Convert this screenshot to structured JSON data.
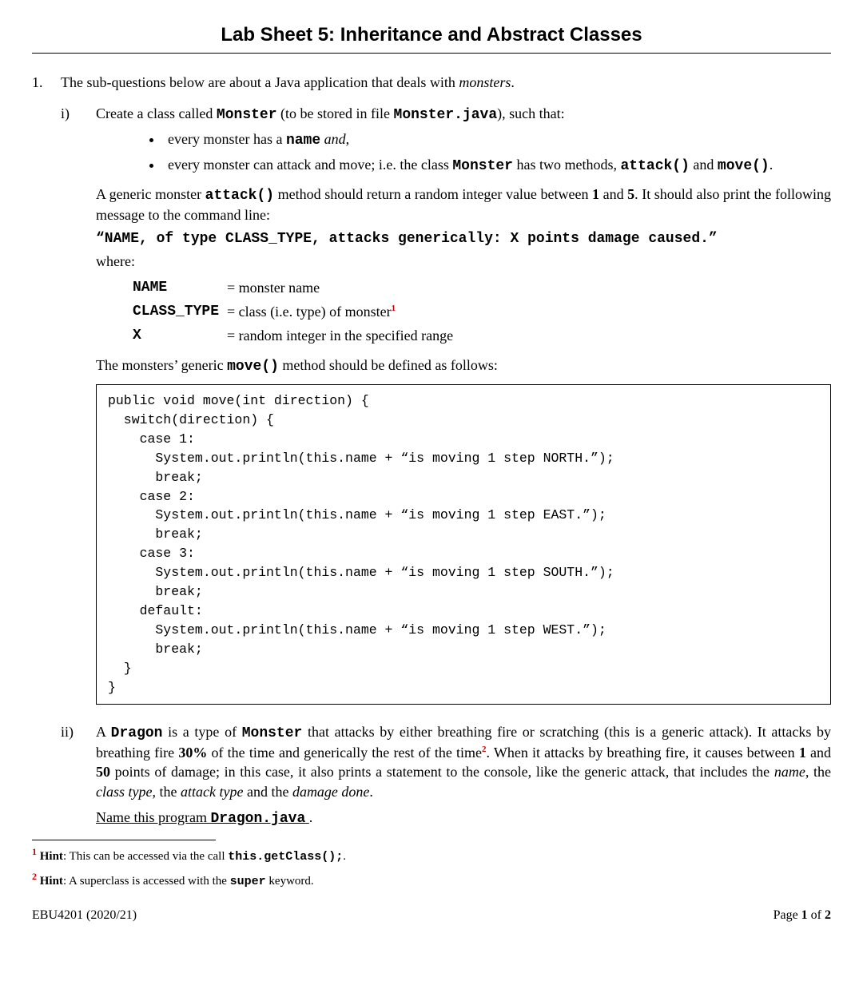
{
  "title": "Lab Sheet 5: Inheritance and Abstract Classes",
  "q1": {
    "num": "1.",
    "intro_pre": "The sub-questions below are about a Java application that deals with ",
    "intro_italic": "monsters",
    "intro_post": "."
  },
  "qi": {
    "roman": "i)",
    "line1_a": "Create a class called ",
    "line1_b": "Monster",
    "line1_c": " (to be stored in file ",
    "line1_d": "Monster.java",
    "line1_e": "), such that:",
    "bullet1_a": "every monster has a ",
    "bullet1_b": "name",
    "bullet1_c": " and",
    "bullet1_d": ",",
    "bullet2_a": "every monster can attack and move; i.e. the class ",
    "bullet2_b": "Monster",
    "bullet2_c": " has two methods, ",
    "bullet2_d": "attack()",
    "bullet2_e": " and ",
    "bullet2_f": "move()",
    "bullet2_g": ".",
    "para2_a": "A generic monster ",
    "para2_b": "attack()",
    "para2_c": " method should return a random integer value between ",
    "para2_d": "1",
    "para2_e": " and ",
    "para2_f": "5",
    "para2_g": ". It should also print the following message to the command line:",
    "attack_msg": "“NAME, of type CLASS_TYPE, attacks generically: X points damage caused.”",
    "where_label": "where:",
    "where": [
      {
        "k": "NAME",
        "v": "= monster name",
        "sup": ""
      },
      {
        "k": "CLASS_TYPE",
        "v": "= class (i.e. type) of monster",
        "sup": "1"
      },
      {
        "k": "X",
        "v": "= random integer in the specified range",
        "sup": ""
      }
    ],
    "para3_a": "The monsters’ generic ",
    "para3_b": "move()",
    "para3_c": " method should be defined as follows:",
    "code": "public void move(int direction) {\n  switch(direction) {\n    case 1:\n      System.out.println(this.name + “is moving 1 step NORTH.”);\n      break;\n    case 2:\n      System.out.println(this.name + “is moving 1 step EAST.”);\n      break;\n    case 3:\n      System.out.println(this.name + “is moving 1 step SOUTH.”);\n      break;\n    default:\n      System.out.println(this.name + “is moving 1 step WEST.”);\n      break;\n  }\n}"
  },
  "qii": {
    "roman": "ii)",
    "p1_a": "A ",
    "p1_b": "Dragon",
    "p1_c": " is a type of ",
    "p1_d": "Monster",
    "p1_e": " that attacks by either breathing fire or scratching (this is a generic attack). It attacks by breathing fire ",
    "p1_f": "30%",
    "p1_g": " of the time and generically the rest of the time",
    "p1_sup": "2",
    "p1_h": ". When it attacks by breathing fire, it causes between ",
    "p1_i": "1",
    "p1_j": " and ",
    "p1_k": "50",
    "p1_l": " points of damage; in this case, it also prints a statement to the console, like the generic attack, that includes the ",
    "p1_m": "name",
    "p1_n": ", the ",
    "p1_o": "class type",
    "p1_p": ", the ",
    "p1_q": "attack type",
    "p1_r": " and the ",
    "p1_s": "damage done",
    "p1_t": ".",
    "name_a": "Name this program ",
    "name_b": "Dragon.java",
    "name_c": "."
  },
  "footnotes": {
    "f1_mark": "1",
    "f1_a": " Hint",
    "f1_b": ": This can be accessed via the call ",
    "f1_c": "this.getClass();",
    "f1_d": ".",
    "f2_mark": "2",
    "f2_a": " Hint",
    "f2_b": ": A superclass is accessed with the ",
    "f2_c": "super",
    "f2_d": " keyword."
  },
  "footer": {
    "left": "EBU4201 (2020/21)",
    "right_a": "Page ",
    "right_b": "1",
    "right_c": " of ",
    "right_d": "2"
  }
}
